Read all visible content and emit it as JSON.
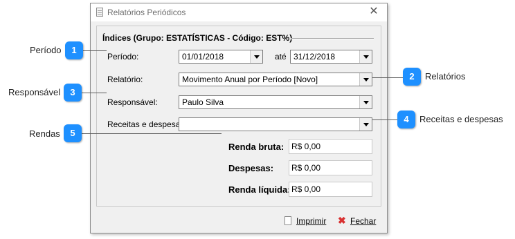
{
  "dialog": {
    "title": "Relatórios Periódicos",
    "group_title": "Índices (Grupo: ESTATÍSTICAS - Código: EST%)",
    "periodo_label": "Período:",
    "periodo_inicio": "01/01/2018",
    "ate_label": "até",
    "periodo_fim": "31/12/2018",
    "relatorio_label": "Relatório:",
    "relatorio_value": "Movimento Anual por Período [Novo]",
    "responsavel_label": "Responsável:",
    "responsavel_value": "Paulo Silva",
    "receitas_label": "Receitas e despesas:",
    "receitas_value": "",
    "renda_bruta_label": "Renda bruta:",
    "renda_bruta_value": "R$ 0,00",
    "despesas_label": "Despesas:",
    "despesas_value": "R$ 0,00",
    "renda_liquida_label": "Renda líquida:",
    "renda_liquida_value": "R$ 0,00",
    "imprimir_label": "Imprimir",
    "fechar_label": "Fechar",
    "close_glyph": "✕"
  },
  "callouts": [
    {
      "number": "1",
      "text": "Período"
    },
    {
      "number": "2",
      "text": "Relatórios"
    },
    {
      "number": "3",
      "text": "Responsável"
    },
    {
      "number": "4",
      "text": "Receitas e despesas"
    },
    {
      "number": "5",
      "text": "Rendas"
    }
  ],
  "colors": {
    "callout": "#1e90ff",
    "fechar_icon": "#d83030"
  }
}
